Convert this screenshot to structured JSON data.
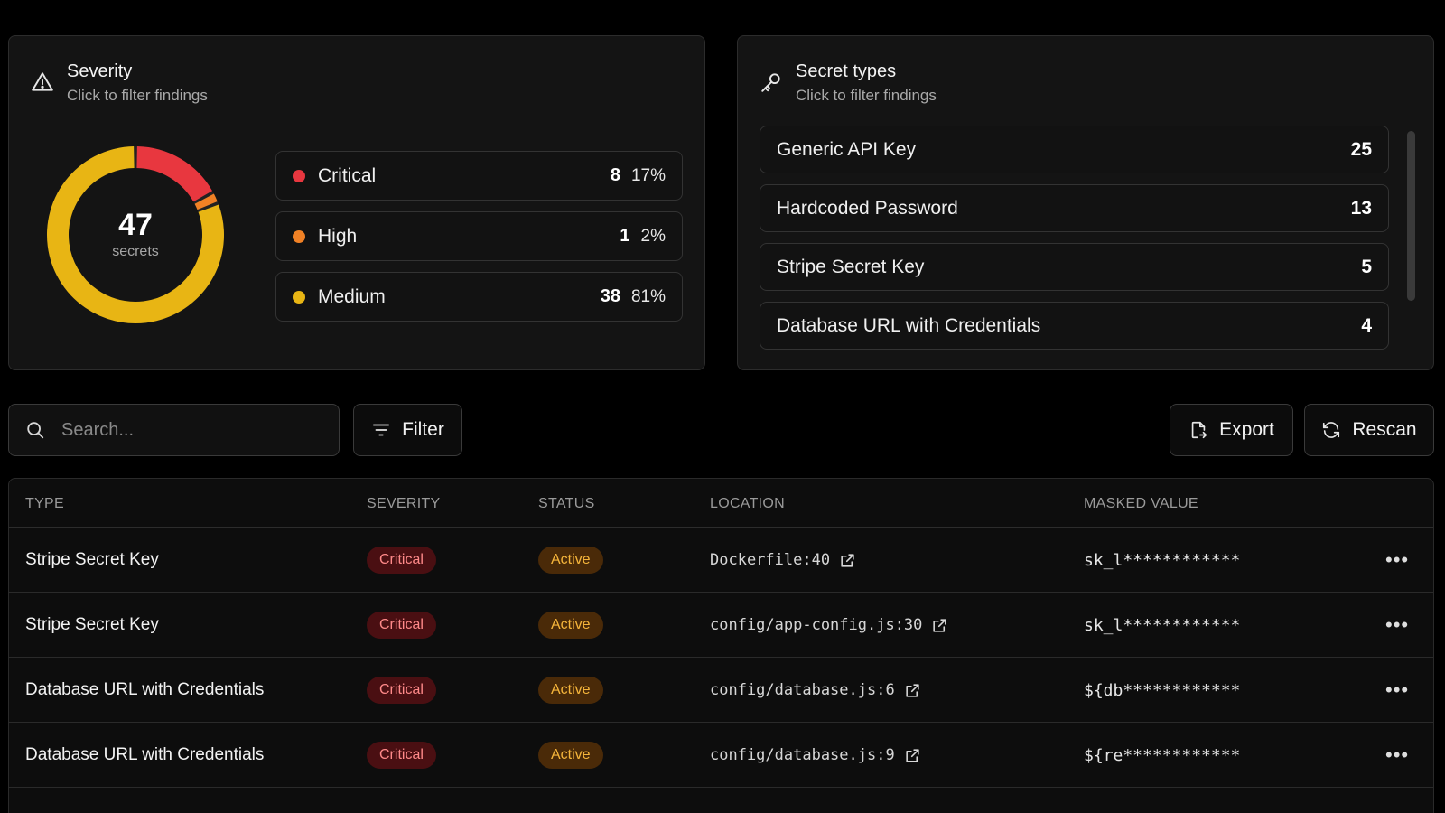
{
  "colors": {
    "critical": "#e8373f",
    "high": "#f08125",
    "medium": "#e8b514",
    "ring_bg": "#222222"
  },
  "severity_card": {
    "title": "Severity",
    "subtitle": "Click to filter findings",
    "icon": "warning-triangle-icon",
    "total": "47",
    "total_unit": "secrets",
    "items": [
      {
        "name": "Critical",
        "count": "8",
        "percent": "17%",
        "value": 8,
        "color": "#e8373f"
      },
      {
        "name": "High",
        "count": "1",
        "percent": "2%",
        "value": 1,
        "color": "#f08125"
      },
      {
        "name": "Medium",
        "count": "38",
        "percent": "81%",
        "value": 38,
        "color": "#e8b514"
      }
    ]
  },
  "types_card": {
    "title": "Secret types",
    "subtitle": "Click to filter findings",
    "icon": "key-icon",
    "items": [
      {
        "name": "Generic API Key",
        "count": "25"
      },
      {
        "name": "Hardcoded Password",
        "count": "13"
      },
      {
        "name": "Stripe Secret Key",
        "count": "5"
      },
      {
        "name": "Database URL with Credentials",
        "count": "4"
      }
    ]
  },
  "toolbar": {
    "search_placeholder": "Search...",
    "filter_label": "Filter",
    "export_label": "Export",
    "rescan_label": "Rescan"
  },
  "table": {
    "headers": [
      "TYPE",
      "SEVERITY",
      "STATUS",
      "LOCATION",
      "MASKED VALUE"
    ],
    "rows": [
      {
        "type": "Stripe Secret Key",
        "severity": "Critical",
        "status": "Active",
        "location": "Dockerfile:40",
        "masked": "sk_l************"
      },
      {
        "type": "Stripe Secret Key",
        "severity": "Critical",
        "status": "Active",
        "location": "config/app-config.js:30",
        "masked": "sk_l************"
      },
      {
        "type": "Database URL with Credentials",
        "severity": "Critical",
        "status": "Active",
        "location": "config/database.js:6",
        "masked": "${db************"
      },
      {
        "type": "Database URL with Credentials",
        "severity": "Critical",
        "status": "Active",
        "location": "config/database.js:9",
        "masked": "${re************"
      }
    ],
    "more_label": "•••"
  }
}
